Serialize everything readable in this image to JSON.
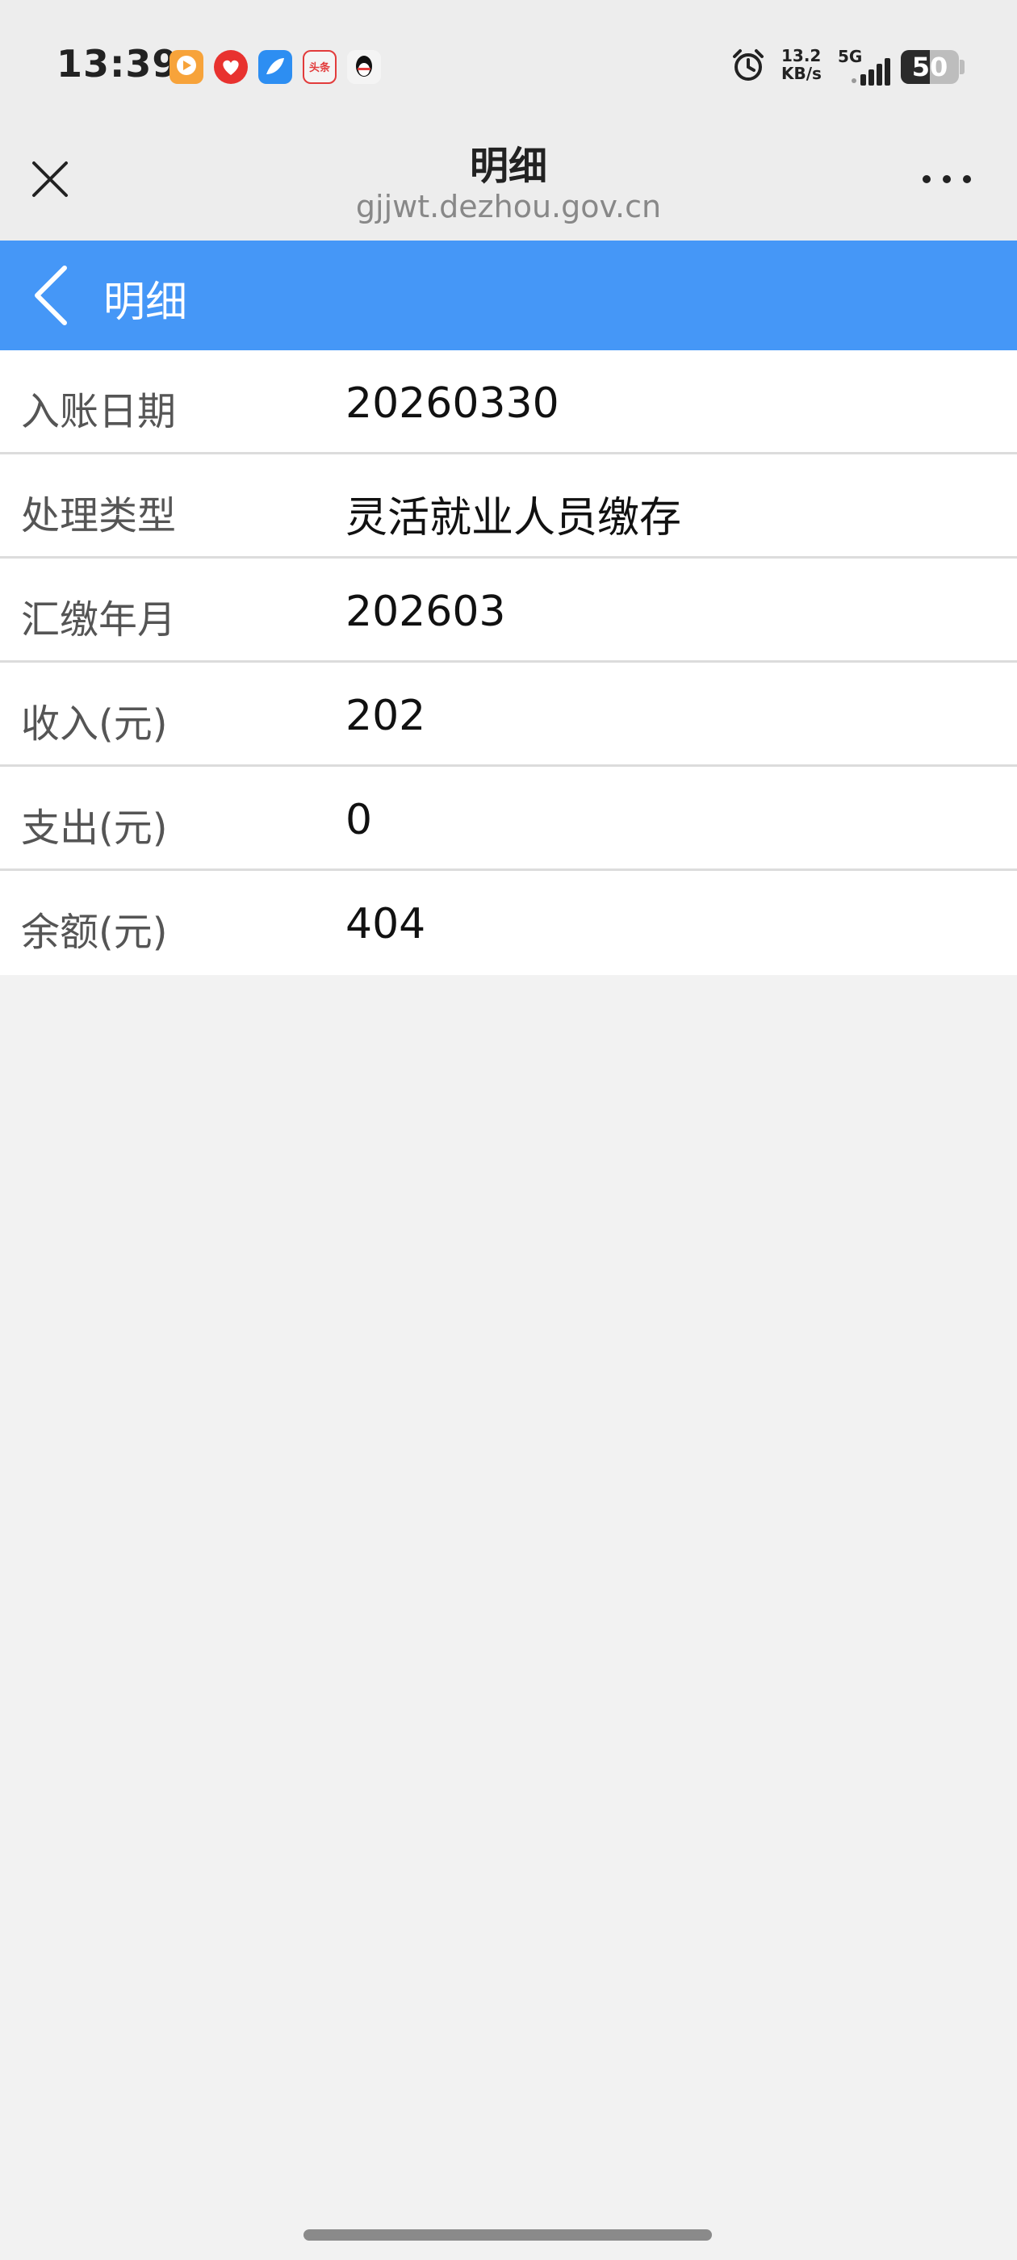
{
  "status_bar": {
    "time": "13:39",
    "app_icons": [
      "video-app-icon",
      "heart-app-icon",
      "browser-app-icon",
      "toutiao-app-icon",
      "qq-app-icon"
    ],
    "toutiao_text": "头条",
    "net_speed_value": "13.2",
    "net_speed_unit": "KB/s",
    "network_type": "5G",
    "battery_level": "50",
    "battery_percent": 50
  },
  "browser": {
    "title": "明细",
    "url": "gjjwt.dezhou.gov.cn"
  },
  "page": {
    "title": "明细",
    "accent_color": "#4597f7"
  },
  "details": [
    {
      "label": "入账日期",
      "value": "20260330"
    },
    {
      "label": "处理类型",
      "value": "灵活就业人员缴存"
    },
    {
      "label": "汇缴年月",
      "value": "202603"
    },
    {
      "label": "收入(元)",
      "value": "202"
    },
    {
      "label": "支出(元)",
      "value": "0"
    },
    {
      "label": "余额(元)",
      "value": "404"
    }
  ]
}
